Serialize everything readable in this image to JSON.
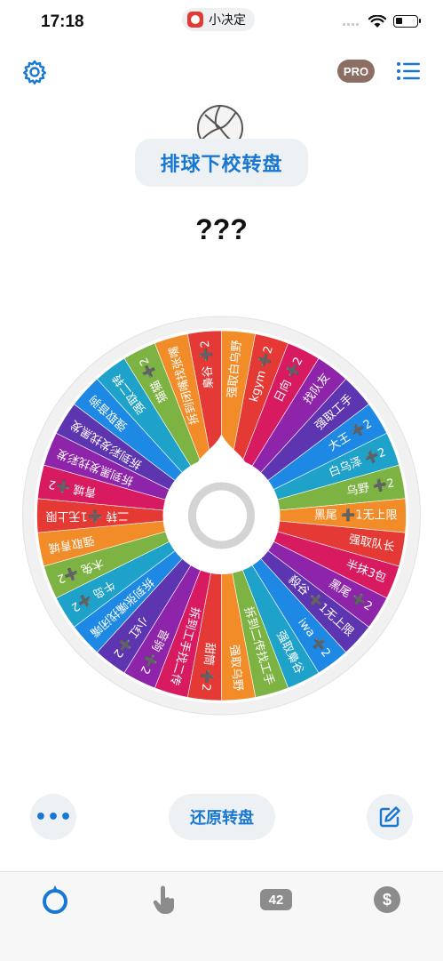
{
  "status": {
    "time": "17:18",
    "app_name": "小决定",
    "battery_level": 0.35
  },
  "header": {
    "pro_label": "PRO"
  },
  "wheel_title": "排球下校转盘",
  "result": "???",
  "wheel": {
    "segments": [
      {
        "label": "强取白乌野",
        "color": "#f28c28"
      },
      {
        "label": "kgym ➕2",
        "color": "#e53935"
      },
      {
        "label": "日向 ➕2",
        "color": "#d81b60"
      },
      {
        "label": "找队友",
        "color": "#8e24aa"
      },
      {
        "label": "强取工手",
        "color": "#5e35b1"
      },
      {
        "label": "大王 ➕2",
        "color": "#1e88e5"
      },
      {
        "label": "白乌泽 ➕2",
        "color": "#1fa2c9"
      },
      {
        "label": "乌野 ➕2",
        "color": "#7cb342"
      },
      {
        "label": "黑尾 ➕1无上限",
        "color": "#f28c28"
      },
      {
        "label": "强取队长",
        "color": "#e53935"
      },
      {
        "label": "半抹3包",
        "color": "#d81b60"
      },
      {
        "label": "黑尾 ➕2",
        "color": "#8e24aa"
      },
      {
        "label": "殺谷 ➕1无上限",
        "color": "#5e35b1"
      },
      {
        "label": "iwa ➕2",
        "color": "#1e88e5"
      },
      {
        "label": "强取梟谷",
        "color": "#1fa2c9"
      },
      {
        "label": "拆到二传找工手",
        "color": "#7cb342"
      },
      {
        "label": "强取乌野",
        "color": "#f28c28"
      },
      {
        "label": "甜筒 ➕2",
        "color": "#e53935"
      },
      {
        "label": "拆到工手找二传",
        "color": "#d81b60"
      },
      {
        "label": "音驹 ➕2",
        "color": "#8e24aa"
      },
      {
        "label": "小红 ➕2",
        "color": "#5e35b1"
      },
      {
        "label": "拆到张嘴找闭嘴",
        "color": "#1e88e5"
      },
      {
        "label": "牛岛 ➕2",
        "color": "#1fa2c9"
      },
      {
        "label": "木兔 ➕2",
        "color": "#7cb342"
      },
      {
        "label": "强取青城",
        "color": "#f28c28"
      },
      {
        "label": "二转 ➕1无上限",
        "color": "#e53935"
      },
      {
        "label": "青城 ➕2",
        "color": "#d81b60"
      },
      {
        "label": "拆到黑发找彩发",
        "color": "#8e24aa"
      },
      {
        "label": "拆到彩发找黑发",
        "color": "#5e35b1"
      },
      {
        "label": "强取音驹",
        "color": "#1e88e5"
      },
      {
        "label": "强取二转",
        "color": "#1fa2c9"
      },
      {
        "label": "猫猫 ➕2",
        "color": "#7cb342"
      },
      {
        "label": "拆到闭嘴找张嘴",
        "color": "#f28c28"
      },
      {
        "label": "梟谷 ➕2",
        "color": "#e53935"
      }
    ]
  },
  "actions": {
    "more_label": "•••",
    "reset_label": "还原转盘"
  },
  "tabs": {
    "count_badge": "42",
    "dollar_label": "$"
  },
  "colors": {
    "accent": "#1877d2"
  }
}
